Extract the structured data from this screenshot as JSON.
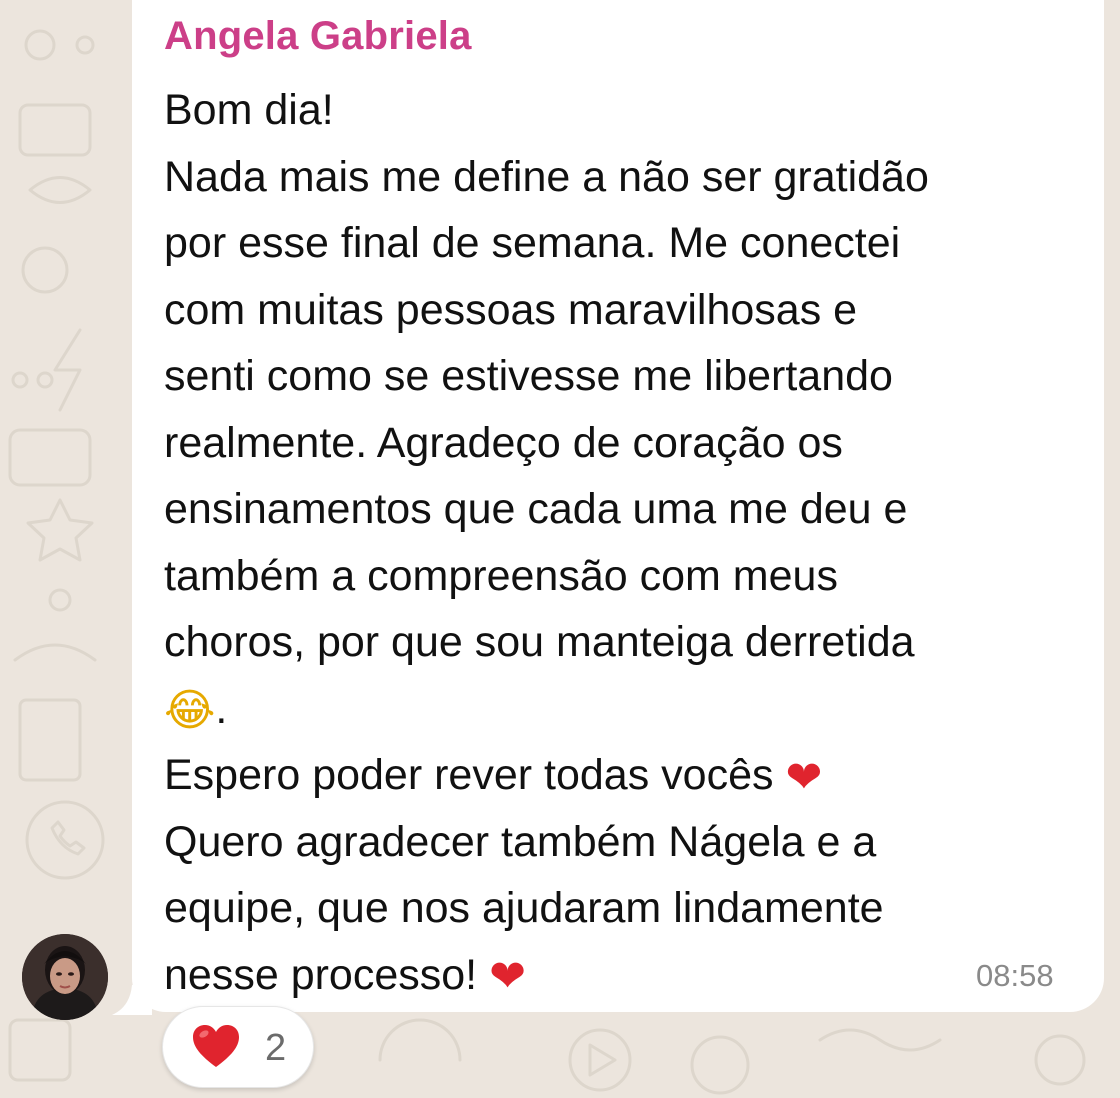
{
  "message": {
    "sender_name": "Angela Gabriela",
    "lines": [
      "Bom dia!",
      "Nada mais me define a não ser gratidão",
      "por esse final de semana.  Me conectei",
      "com muitas pessoas maravilhosas e",
      "senti como se estivesse me libertando",
      "realmente. Agradeço de coração os",
      "ensinamentos que cada uma me deu e",
      "também a compreensão com meus",
      "choros, por que sou manteiga derretida",
      "Espero poder rever todas vocês",
      "Quero agradecer também Nágela e a",
      "equipe, que nos ajudaram lindamente",
      "nesse processo!"
    ],
    "laugh_emoji": "😂",
    "laugh_trailing": ".",
    "heart_emoji": "❤",
    "timestamp": "08:58"
  },
  "reaction": {
    "emoji": "❤",
    "count": "2"
  },
  "colors": {
    "chat_background": "#ece5dd",
    "bubble": "#ffffff",
    "sender_name": "#cc3f88",
    "text": "#111111",
    "timestamp": "#8a8a8a",
    "heart": "#e0242e"
  },
  "icons": {
    "heart": "heart-icon",
    "laugh": "tears-of-joy-emoji-icon",
    "avatar": "user-avatar"
  }
}
